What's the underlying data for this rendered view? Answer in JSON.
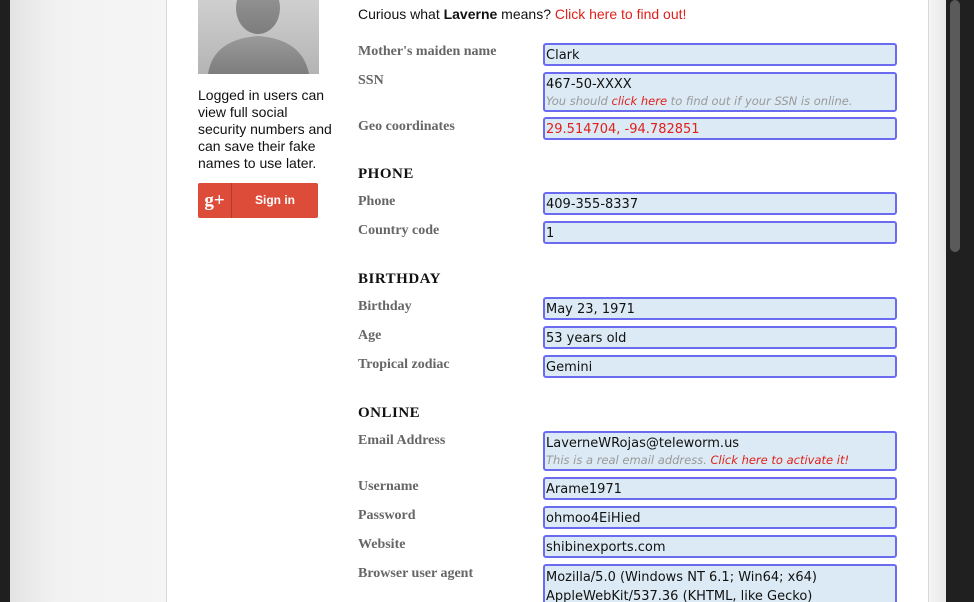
{
  "sidebar": {
    "login_note": "Logged in users can view full social security numbers and can save their fake names to use later.",
    "signin": {
      "logo": "g+",
      "label": "Sign in"
    }
  },
  "intro": {
    "prefix": "Curious what ",
    "name": "Laverne",
    "middle": " means? ",
    "link": "Click here to find out!"
  },
  "identity": {
    "maiden": {
      "label": "Mother's maiden name",
      "value": "Clark"
    },
    "ssn": {
      "label": "SSN",
      "value": "467-50-XXXX",
      "hint_pre": "You should ",
      "hint_link": "click here",
      "hint_post": " to find out if your SSN is online."
    },
    "geo": {
      "label": "Geo coordinates",
      "value": "29.514704, -94.782851"
    }
  },
  "phone": {
    "heading": "PHONE",
    "phone": {
      "label": "Phone",
      "value": "409-355-8337"
    },
    "country": {
      "label": "Country code",
      "value": "1"
    }
  },
  "birthday": {
    "heading": "BIRTHDAY",
    "birthday": {
      "label": "Birthday",
      "value": "May 23, 1971"
    },
    "age": {
      "label": "Age",
      "value": "53 years old"
    },
    "zodiac": {
      "label": "Tropical zodiac",
      "value": "Gemini"
    }
  },
  "online": {
    "heading": "ONLINE",
    "email": {
      "label": "Email Address",
      "value": "LaverneWRojas@teleworm.us",
      "hint_pre": "This is a real email address. ",
      "hint_link": "Click here to activate it!"
    },
    "username": {
      "label": "Username",
      "value": "Arame1971"
    },
    "password": {
      "label": "Password",
      "value": "ohmoo4EiHied"
    },
    "website": {
      "label": "Website",
      "value": "shibinexports.com"
    },
    "agent": {
      "label": "Browser user agent",
      "line1": "Mozilla/5.0 (Windows NT 6.1; Win64; x64)",
      "line2": "AppleWebKit/537.36 (KHTML, like Gecko)"
    }
  }
}
